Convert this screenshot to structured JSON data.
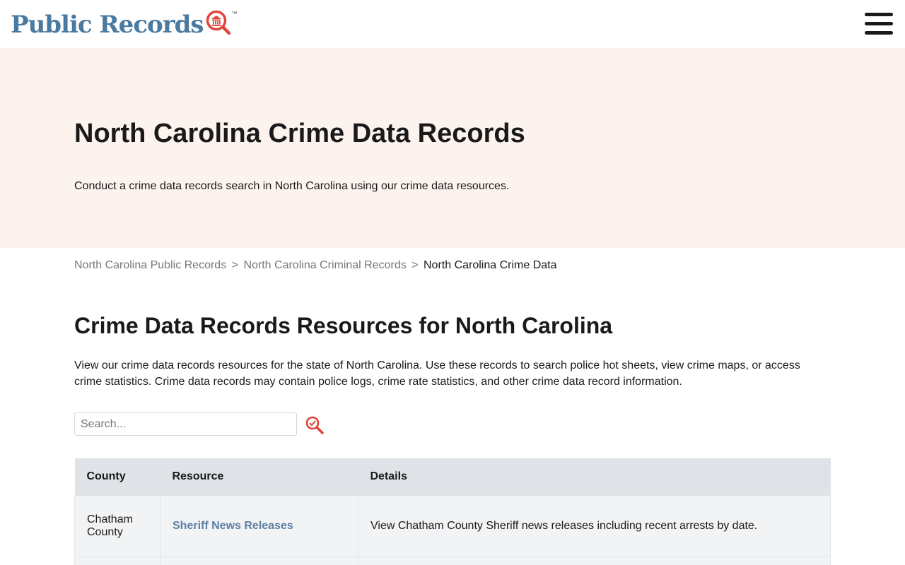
{
  "header": {
    "logo_text": "Public Records",
    "logo_tm": "™",
    "brand_color": "#4a7aa0",
    "accent_color": "#e0453a",
    "menu_icon": "hamburger-menu-icon"
  },
  "hero": {
    "title": "North Carolina Crime Data Records",
    "subtitle": "Conduct a crime data records search in North Carolina using our crime data resources.",
    "background": "#fcf3ee"
  },
  "breadcrumb": {
    "items": [
      {
        "label": "North Carolina Public Records"
      },
      {
        "label": "North Carolina Criminal Records"
      }
    ],
    "separator": ">",
    "current": "North Carolina Crime Data"
  },
  "main": {
    "title": "Crime Data Records Resources for North Carolina",
    "description": "View our crime data records resources for the state of North Carolina. Use these records to search police hot sheets, view crime maps, or access crime statistics. Crime data records may contain police logs, crime rate statistics, and other crime data record information."
  },
  "search": {
    "placeholder": "Search...",
    "value": "",
    "button_icon": "search-magnifier-icon"
  },
  "table": {
    "headers": {
      "county": "County",
      "resource": "Resource",
      "details": "Details"
    },
    "rows": [
      {
        "county": "Chatham County",
        "resource": "Sheriff News Releases",
        "details": "View Chatham County Sheriff news releases including recent arrests by date."
      },
      {
        "county": "",
        "resource": "",
        "details": ""
      }
    ]
  }
}
